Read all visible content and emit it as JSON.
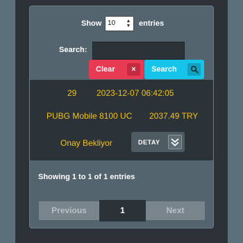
{
  "controls": {
    "show_label": "Show",
    "page_size": "10",
    "entries_label": "entries",
    "search_label": "Search:",
    "search_value": ""
  },
  "buttons": {
    "clear_label": "Clear",
    "clear_icon": "×",
    "search_label": "Search"
  },
  "row": {
    "id": "29",
    "datetime": "2023-12-07 06:42:05",
    "product": "PUBG Mobile 8100 UC",
    "amount": "2037.49 TRY",
    "status": "Onay Bekliyor",
    "detail_label": "DETAY"
  },
  "footer": {
    "info": "Showing 1 to 1 of 1 entries",
    "prev_label": "Previous",
    "current_page": "1",
    "next_label": "Next"
  },
  "colors": {
    "clear": "#e83a52",
    "search": "#15c4e8",
    "row_text": "#f3c21a"
  },
  "icons": {
    "clear": "close-icon",
    "search": "magnifier-icon",
    "select": "sort-arrows-icon",
    "detail": "double-chevron-down-icon"
  }
}
